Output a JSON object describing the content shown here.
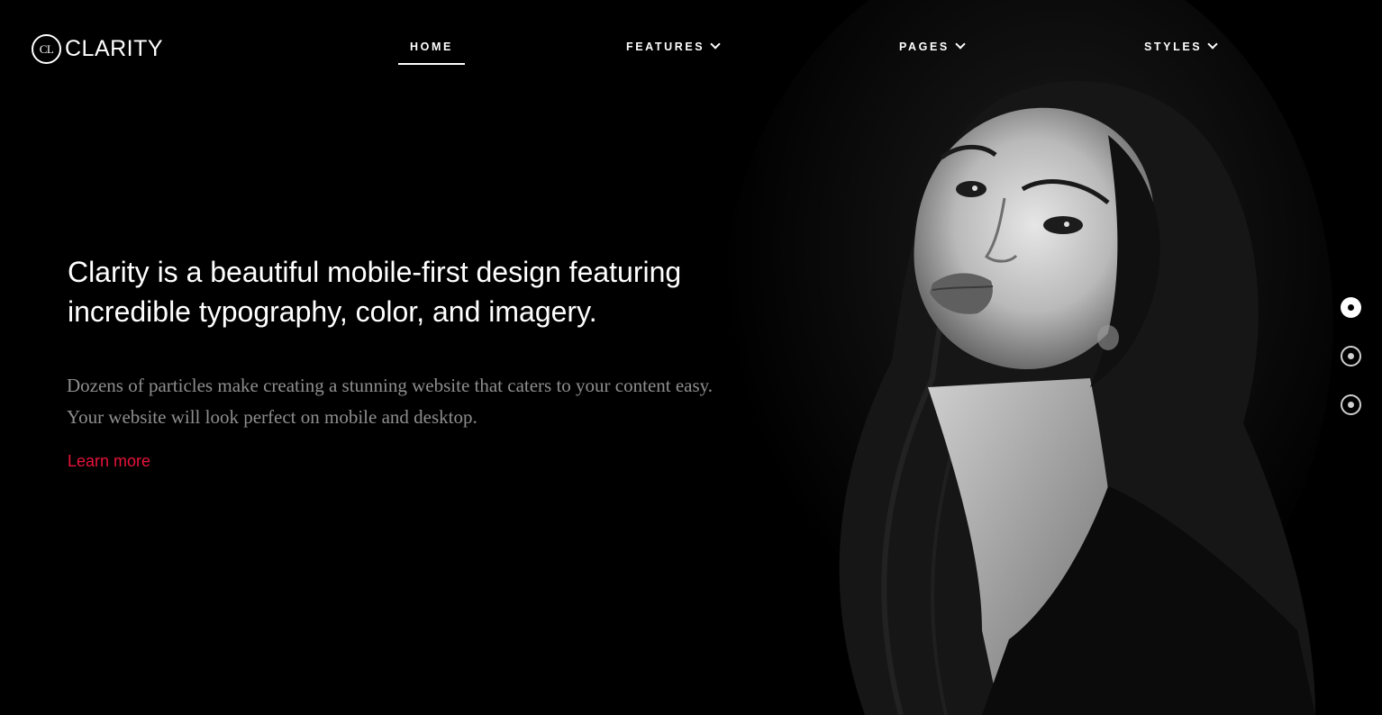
{
  "logo": {
    "mark": "CL",
    "text": "CLARITY"
  },
  "nav": {
    "items": [
      {
        "label": "HOME",
        "active": true,
        "has_dropdown": false
      },
      {
        "label": "FEATURES",
        "active": false,
        "has_dropdown": true
      },
      {
        "label": "PAGES",
        "active": false,
        "has_dropdown": true
      },
      {
        "label": "STYLES",
        "active": false,
        "has_dropdown": true
      }
    ]
  },
  "hero": {
    "title": "Clarity is a beautiful mobile-first design featuring incredible typography, color, and imagery.",
    "subtitle": "Dozens of particles make creating a stunning website that caters to your content easy. Your website will look perfect on mobile and desktop.",
    "link_label": "Learn more",
    "image": "black-and-white-portrait-of-woman"
  },
  "slider": {
    "count": 3,
    "active_index": 0
  },
  "colors": {
    "background": "#000000",
    "accent": "#e8133a",
    "subtitle": "#8e8e8e",
    "text": "#ffffff"
  }
}
